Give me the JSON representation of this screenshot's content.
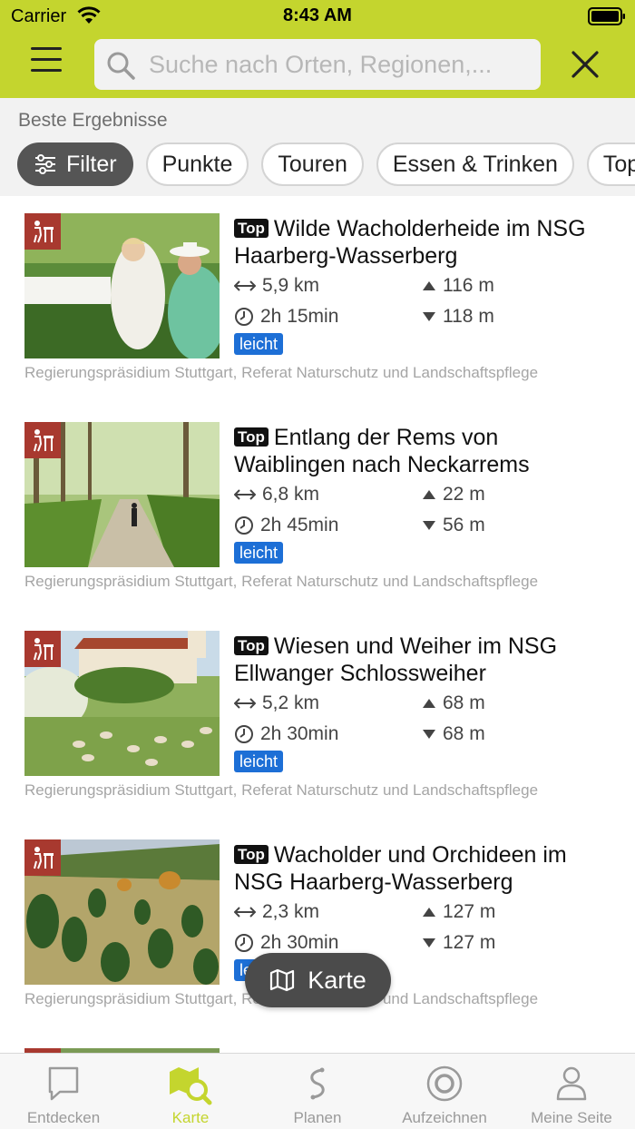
{
  "status_bar": {
    "carrier": "Carrier",
    "time": "8:43 AM"
  },
  "search": {
    "placeholder": "Suche nach Orten, Regionen,..."
  },
  "results": {
    "section_label": "Beste Ergebnisse",
    "filter_label": "Filter",
    "chips": [
      "Punkte",
      "Touren",
      "Essen & Trinken",
      "Top"
    ]
  },
  "items": [
    {
      "badge": "Top",
      "title": "Wilde Wacholderheide im NSG Haarberg-Wasserberg",
      "distance": "5,9 km",
      "duration": "2h 15min",
      "ascent": "116 m",
      "descent": "118 m",
      "difficulty": "leicht",
      "source": "Regierungspräsidium Stuttgart, Referat Naturschutz und Landschaftspflege"
    },
    {
      "badge": "Top",
      "title": "Entlang der Rems von Waiblingen nach Neckarrems",
      "distance": "6,8 km",
      "duration": "2h 45min",
      "ascent": "22 m",
      "descent": "56 m",
      "difficulty": "leicht",
      "source": "Regierungspräsidium Stuttgart, Referat Naturschutz und Landschaftspflege"
    },
    {
      "badge": "Top",
      "title": "Wiesen und Weiher im NSG Ellwanger Schlossweiher",
      "distance": "5,2 km",
      "duration": "2h 30min",
      "ascent": "68 m",
      "descent": "68 m",
      "difficulty": "leicht",
      "source": "Regierungspräsidium Stuttgart, Referat Naturschutz und Landschaftspflege"
    },
    {
      "badge": "Top",
      "title": "Wacholder und Orchideen im NSG Haarberg-Wasserberg",
      "distance": "2,3 km",
      "duration": "2h 30min",
      "ascent": "127 m",
      "descent": "127 m",
      "difficulty": "leicht",
      "source": "Regierungspräsidium Stuttgart, Referat Naturschutz und Landschaftspflege"
    }
  ],
  "map_button": {
    "label": "Karte"
  },
  "tabbar": {
    "tabs": [
      {
        "label": "Entdecken",
        "icon": "speech-bubble-icon",
        "active": false
      },
      {
        "label": "Karte",
        "icon": "map-search-icon",
        "active": true
      },
      {
        "label": "Planen",
        "icon": "route-icon",
        "active": false
      },
      {
        "label": "Aufzeichnen",
        "icon": "record-icon",
        "active": false
      },
      {
        "label": "Meine Seite",
        "icon": "user-icon",
        "active": false
      }
    ]
  },
  "colors": {
    "header": "#c4d52e",
    "category": "#a8392f",
    "difficulty": "#1d6fd6",
    "active_tab": "#c4d52e"
  }
}
